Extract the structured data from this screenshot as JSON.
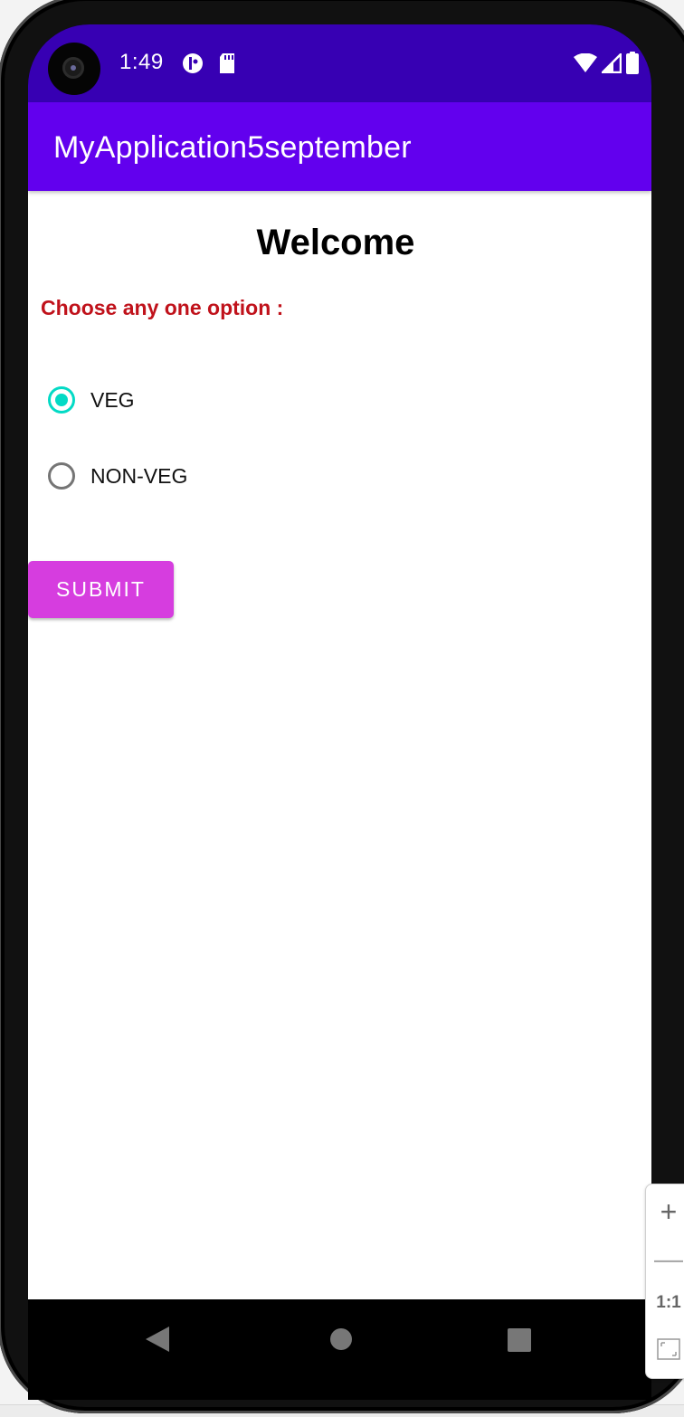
{
  "status_bar": {
    "time": "1:49",
    "icons": [
      "notification-app-icon",
      "sd-card-icon"
    ],
    "right_icons": [
      "wifi-icon",
      "cellular-signal-icon",
      "battery-icon"
    ]
  },
  "app_bar": {
    "title": "MyApplication5september"
  },
  "main": {
    "heading": "Welcome",
    "prompt": "Choose any one option :",
    "options": [
      {
        "label": "VEG",
        "checked": true
      },
      {
        "label": "NON-VEG",
        "checked": false
      }
    ],
    "submit_label": "SUBMIT"
  },
  "nav_bar": {
    "buttons": [
      "back",
      "home",
      "recents"
    ]
  },
  "zoom_controls": {
    "zoom_in": "+",
    "zoom_out": "—",
    "actual_size": "1:1"
  },
  "colors": {
    "status_bar": "#3700b3",
    "app_bar": "#6200ee",
    "prompt_text": "#c0121b",
    "radio_checked": "#03dac5",
    "submit_button": "#d63ddf"
  }
}
